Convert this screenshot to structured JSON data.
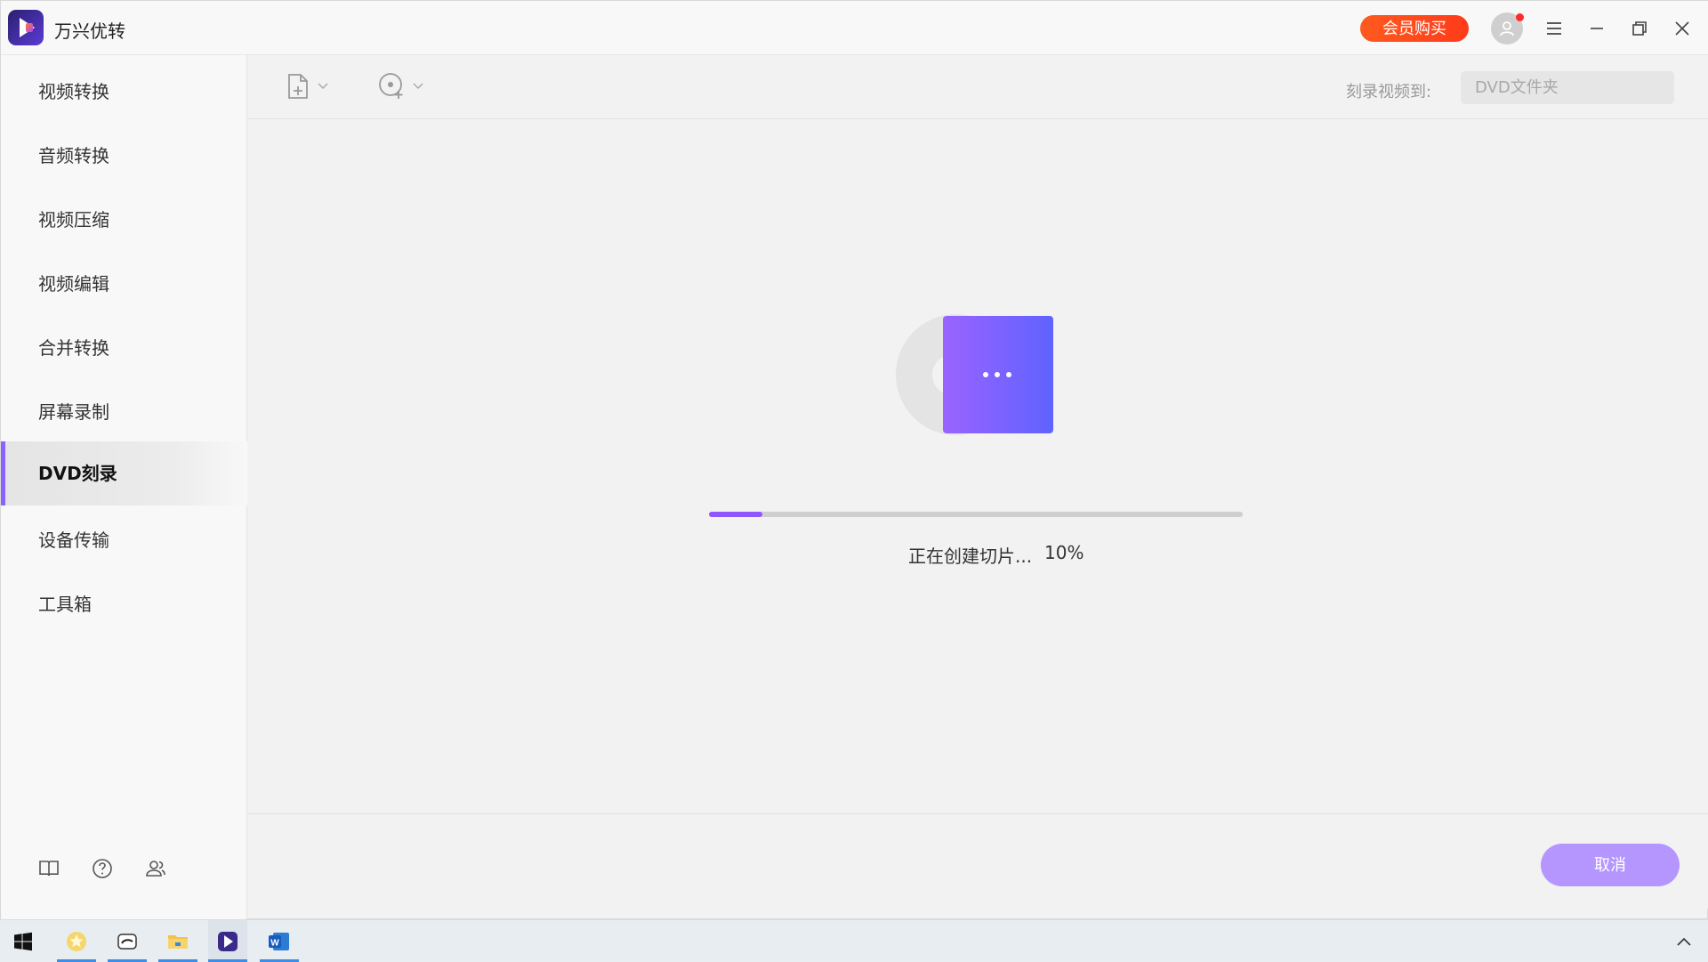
{
  "app": {
    "title": "万兴优转",
    "vip_button": "会员购买"
  },
  "sidebar": {
    "items": [
      {
        "label": "视频转换"
      },
      {
        "label": "音频转换"
      },
      {
        "label": "视频压缩"
      },
      {
        "label": "视频编辑"
      },
      {
        "label": "合并转换"
      },
      {
        "label": "屏幕录制"
      },
      {
        "label": "DVD刻录",
        "active": true
      },
      {
        "label": "设备传输"
      },
      {
        "label": "工具箱"
      }
    ],
    "bottom_icons": [
      "book-icon",
      "help-icon",
      "community-icon"
    ]
  },
  "toolbar": {
    "add_file_icon": "add-file-icon",
    "add_disc_icon": "add-disc-icon",
    "burn_to_label": "刻录视频到:",
    "burn_to_value": "DVD文件夹"
  },
  "progress": {
    "status_text": "正在创建切片...",
    "percent_text": "10%",
    "percent": 10
  },
  "footer": {
    "cancel_label": "取消"
  },
  "taskbar": {
    "apps": [
      "windows-start-icon",
      "favorites-icon",
      "app-icon",
      "file-explorer-icon",
      "wondershare-uniconverter-icon",
      "word-icon"
    ]
  },
  "colors": {
    "accent": "#8f55ff",
    "vip": "#ff4a1f",
    "cancel": "#b596ff"
  }
}
